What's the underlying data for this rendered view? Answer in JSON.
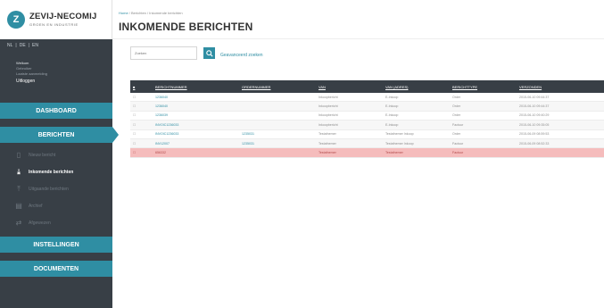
{
  "app": {
    "logo_mark": "Z",
    "logo_name": "ZEVIJ-NECOMIJ",
    "logo_sub": "GROEN EN INDUSTRIE"
  },
  "sidebar": {
    "languages": [
      "NL",
      "DE",
      "EN"
    ],
    "user_lines": [
      "Welkom",
      "Gebruiker",
      "Laatste aanmelding"
    ],
    "logout": "Uitloggen",
    "nav": {
      "dashboard": "DASHBOARD",
      "berichten": "BERICHTEN",
      "instellingen": "INSTELLINGEN",
      "documenten": "DOCUMENTEN"
    },
    "sub_items": [
      {
        "label": "Nieuw bericht",
        "icon": "file-icon",
        "glyph": "▯"
      },
      {
        "label": "Inkomende berichten",
        "icon": "inbox-icon",
        "glyph": "⤓"
      },
      {
        "label": "Uitgaande berichten",
        "icon": "outbox-icon",
        "glyph": "⤒"
      },
      {
        "label": "Archief",
        "icon": "archive-icon",
        "glyph": "▤"
      },
      {
        "label": "Afgewezen",
        "icon": "rejected-icon",
        "glyph": "⇄"
      }
    ]
  },
  "main": {
    "breadcrumb_home": "Home",
    "breadcrumb_rest": " / Berichten / Inkomende berichten",
    "title": "INKOMENDE BERICHTEN",
    "search_placeholder": "Zoeken",
    "search_icon": "search-icon",
    "advanced_link": "Geavanceerd zoeken"
  },
  "table": {
    "columns": [
      "BERICHTNUMMER",
      "ORDERNUMMER",
      "VAN",
      "VAN (ADRES)",
      "BERICHTTYPE",
      "VERZONDEN"
    ],
    "rows": [
      {
        "bericht": "1236040",
        "order": "",
        "van": "Inkoopbericht",
        "adres": "E-Inkoop",
        "type": "Order",
        "verzonden": "2015-06-10 09:44:37",
        "status": "normal"
      },
      {
        "bericht": "1236040",
        "order": "",
        "van": "Inkoopbericht",
        "adres": "E-Inkoop",
        "type": "Order",
        "verzonden": "2015-06-10 09:44:37",
        "status": "normal"
      },
      {
        "bericht": "1236039",
        "order": "",
        "van": "Inkoopbericht",
        "adres": "E-Inkoop",
        "type": "Order",
        "verzonden": "2015-06-10 09:40:29",
        "status": "normal"
      },
      {
        "bericht": "INVOIC1236033",
        "order": "",
        "van": "Inkoopbericht",
        "adres": "E-Inkoop",
        "type": "Factuur",
        "verzonden": "2015-06-10 09:35:05",
        "status": "normal"
      },
      {
        "bericht": "INVOIC1236033",
        "order": "1235031",
        "van": "Testafnemer",
        "adres": "Testafnemer Inkoop",
        "type": "Order",
        "verzonden": "2015-06-09 08:59:53",
        "status": "normal"
      },
      {
        "bericht": "INV12007",
        "order": "1235031",
        "van": "Testafnemer",
        "adres": "Testafnemer Inkoop",
        "type": "Factuur",
        "verzonden": "2015-06-09 08:52:33",
        "status": "normal"
      },
      {
        "bericht": "656332",
        "order": "",
        "van": "Testafnemer",
        "adres": "Testafnemer",
        "type": "Factuur",
        "verzonden": "",
        "status": "error"
      }
    ]
  },
  "colors": {
    "accent": "#2f8ea3",
    "sidebar": "#383f46",
    "error_row": "#f5bcbc"
  }
}
